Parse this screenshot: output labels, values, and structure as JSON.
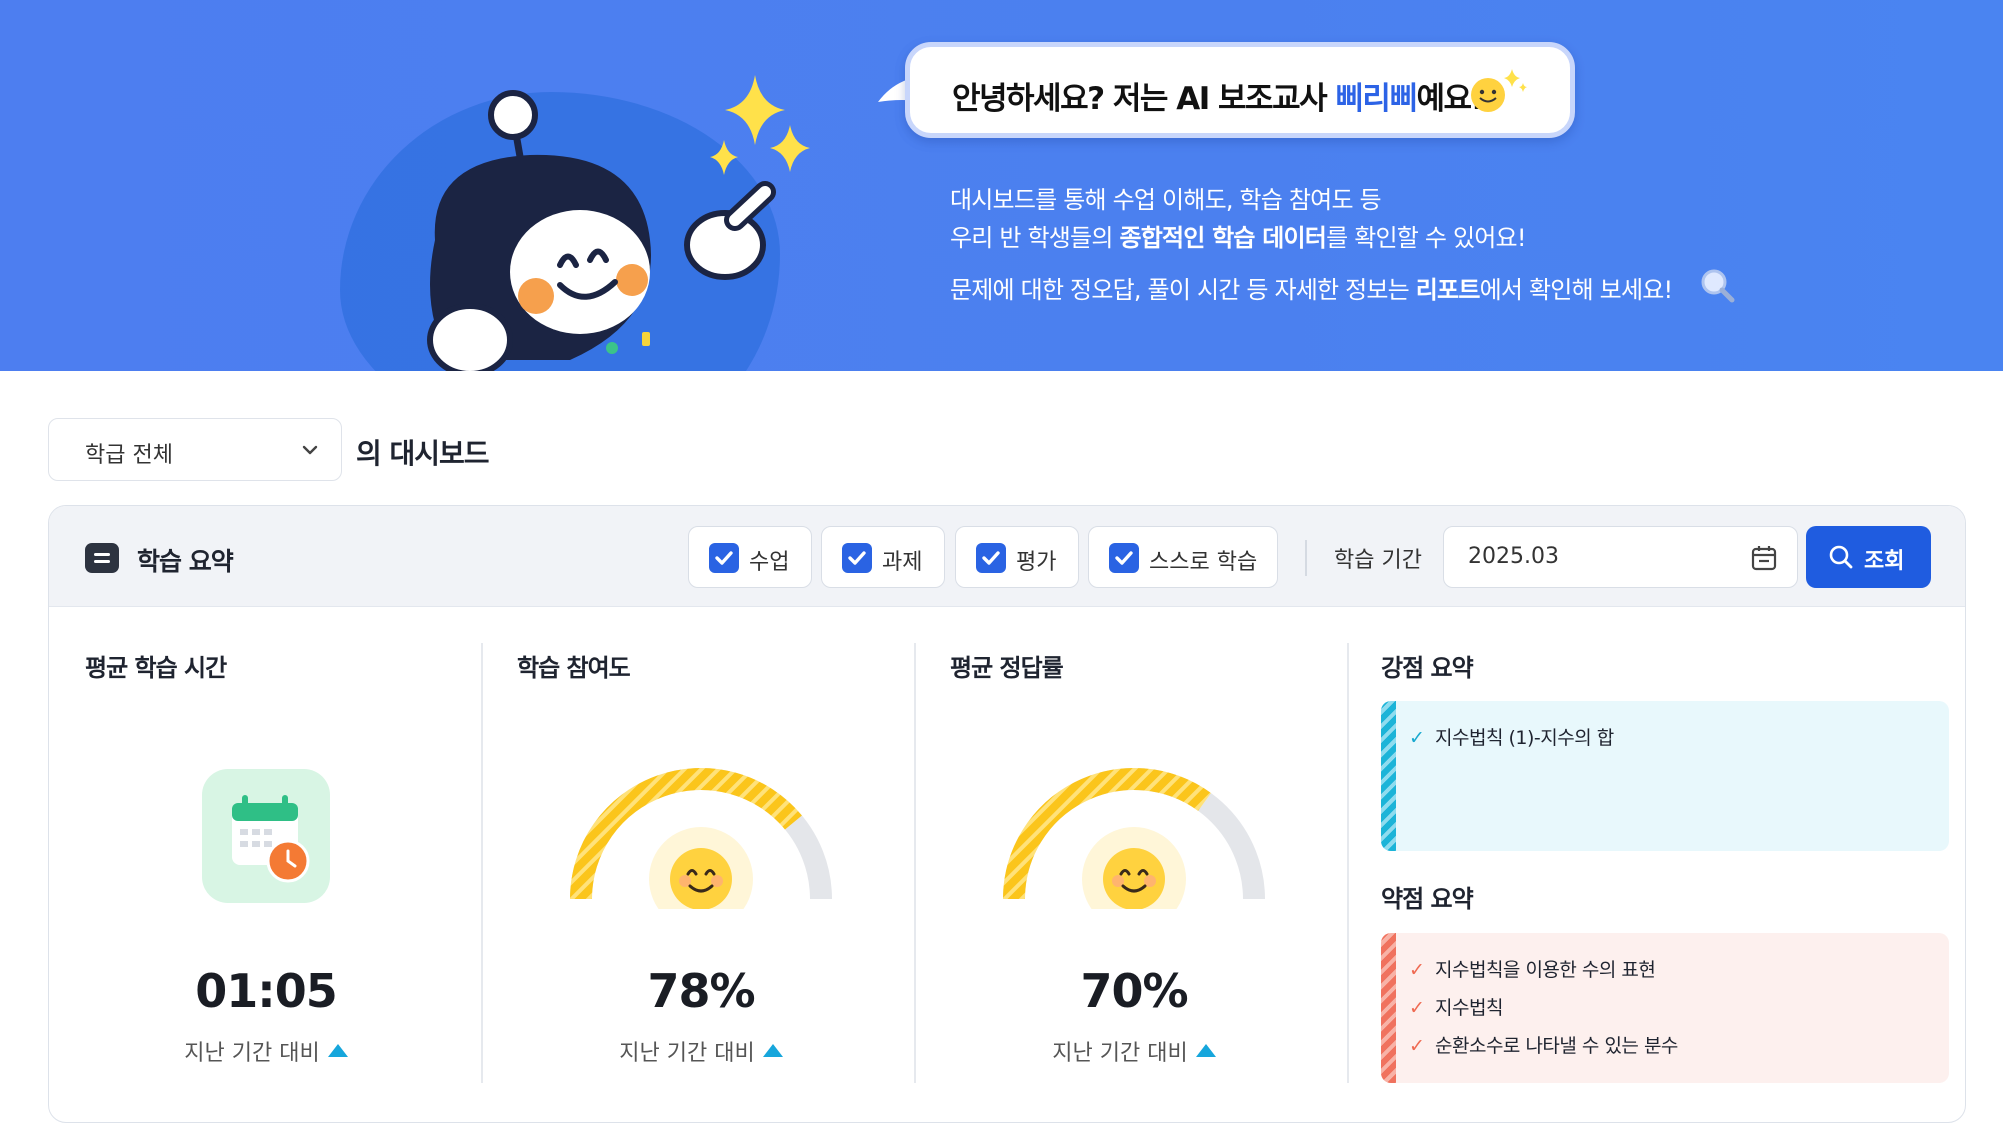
{
  "hero": {
    "greeting_prefix": "안녕하세요? 저는 AI 보조교사 ",
    "assistant_name": "삐리삐",
    "greeting_suffix": "예요!",
    "line1": "대시보드를 통해 수업 이해도, 학습 참여도 등",
    "line2_prefix": "우리 반 학생들의 ",
    "line2_bold": "종합적인 학습 데이터",
    "line2_suffix": "를 확인할 수 있어요!",
    "line3_prefix": "문제에 대한 정오답, 풀이 시간 등 자세한 정보는 ",
    "line3_bold": "리포트",
    "line3_suffix": "에서 확인해 보세요!",
    "background_color": "#4b80ef"
  },
  "filter": {
    "class_select_value": "학급 전체",
    "dashboard_title": "의 대시보드"
  },
  "summary": {
    "title": "학습 요약",
    "checkboxes": [
      {
        "label": "수업",
        "checked": true
      },
      {
        "label": "과제",
        "checked": true
      },
      {
        "label": "평가",
        "checked": true
      },
      {
        "label": "스스로 학습",
        "checked": true
      }
    ],
    "period_label": "학습 기간",
    "period_value": "2025.03",
    "search_label": "조회",
    "accent_color": "#1f5ce0"
  },
  "cards": {
    "time": {
      "title": "평균 학습 시간",
      "value": "01:05",
      "compare": "지난 기간 대비",
      "trend": "up"
    },
    "participation": {
      "title": "학습 참여도",
      "value": "78%",
      "fraction": 0.78,
      "compare": "지난 기간 대비",
      "trend": "up"
    },
    "accuracy": {
      "title": "평균 정답률",
      "value": "70%",
      "fraction": 0.7,
      "compare": "지난 기간 대비",
      "trend": "up"
    }
  },
  "strengths": {
    "title": "강점 요약",
    "items": [
      "지수법칙 (1)-지수의 합"
    ]
  },
  "weaknesses": {
    "title": "약점 요약",
    "items": [
      "지수법칙을 이용한 수의 표현",
      "지수법칙",
      "순환소수로 나타낼 수 있는 분수"
    ]
  },
  "colors": {
    "gauge_fill": "#fbc51b",
    "gauge_track": "#e4e6ea",
    "trend_up": "#16a6dc",
    "strength": "#18a9cf",
    "weakness": "#ef6a52"
  }
}
